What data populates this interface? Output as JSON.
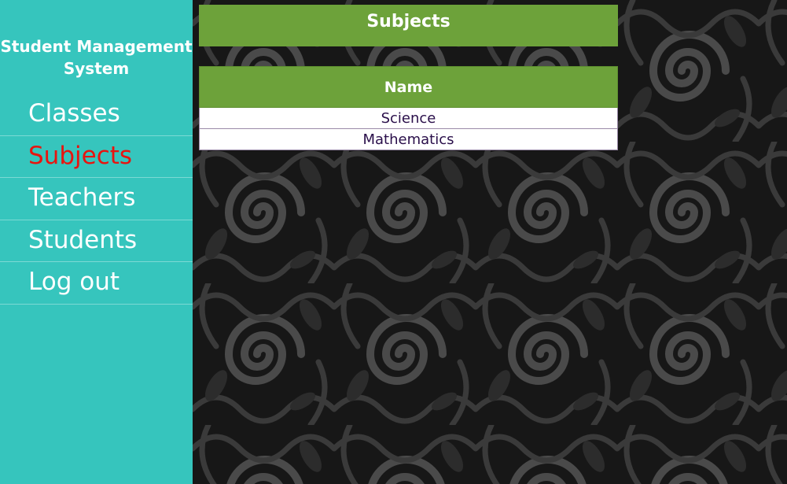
{
  "app": {
    "title": "Student Management System"
  },
  "nav": {
    "items": [
      {
        "label": "Classes",
        "active": false
      },
      {
        "label": "Subjects",
        "active": true
      },
      {
        "label": "Teachers",
        "active": false
      },
      {
        "label": "Students",
        "active": false
      },
      {
        "label": "Log out",
        "active": false
      }
    ]
  },
  "page": {
    "title": "Subjects"
  },
  "table": {
    "columns": [
      "Name"
    ],
    "rows": [
      [
        "Science"
      ],
      [
        "Mathematics"
      ]
    ]
  },
  "colors": {
    "sidebar": "#36c5bd",
    "header_green": "#6da23a",
    "active_nav": "#e8140f",
    "cell_text": "#2a0f4a"
  }
}
